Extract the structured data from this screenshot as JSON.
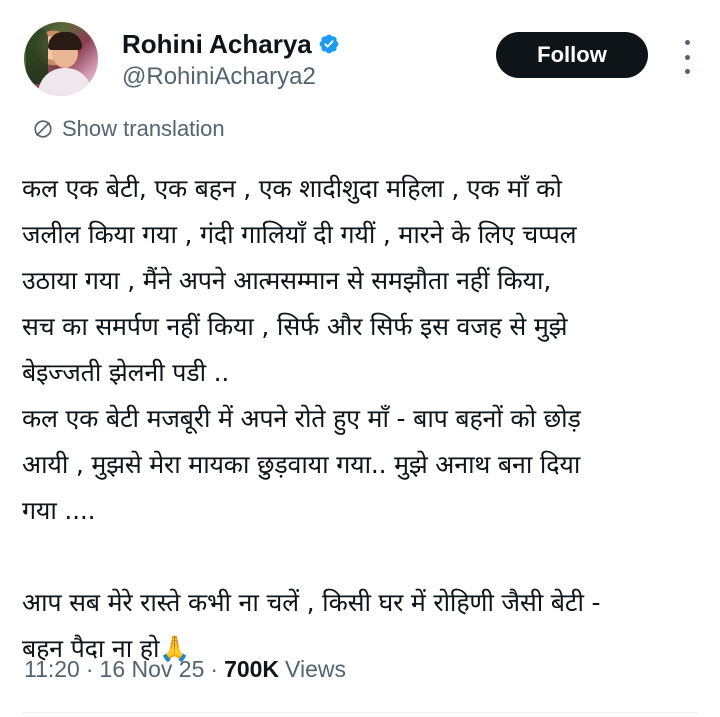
{
  "author": {
    "display_name": "Rohini Acharya",
    "handle": "@RohiniAcharya2",
    "verified": true
  },
  "follow_button": {
    "label": "Follow"
  },
  "translation": {
    "label": "Show translation"
  },
  "tweet": {
    "lines": [
      "कल एक बेटी, एक बहन , एक शादीशुदा महिला , एक माँ को",
      "जलील किया गया , गंदी गालियाँ दी गयीं , मारने के लिए चप्पल",
      "उठाया गया , मैंने  अपने आत्मसम्मान से समझौता नहीं किया,",
      "सच का समर्पण नहीं किया , सिर्फ और सिर्फ इस वजह से मुझे",
      "बेइज्जती झेलनी पडी ..",
      "कल एक बेटी मजबूरी में अपने रोते हुए माँ - बाप बहनों को छोड़",
      "आयी , मुझसे मेरा मायका छुड़वाया गया.. मुझे अनाथ बना दिया",
      "गया ....",
      "",
      "आप सब मेरे रास्ते कभी ना चलें , किसी घर में रोहिणी जैसी बेटी -",
      "बहन  पैदा ना  हो🙏"
    ]
  },
  "meta": {
    "time": "11:20",
    "separator": "·",
    "date": "16 Nov 25",
    "views_count": "700K",
    "views_label": "Views"
  },
  "colors": {
    "text_primary": "#0f1419",
    "text_secondary": "#536471",
    "verified_blue": "#1d9bf0",
    "follow_bg": "#0f1419"
  },
  "icons": {
    "verified": "verified-badge-icon",
    "translate": "translate-globe-icon",
    "more": "more-options-icon"
  }
}
